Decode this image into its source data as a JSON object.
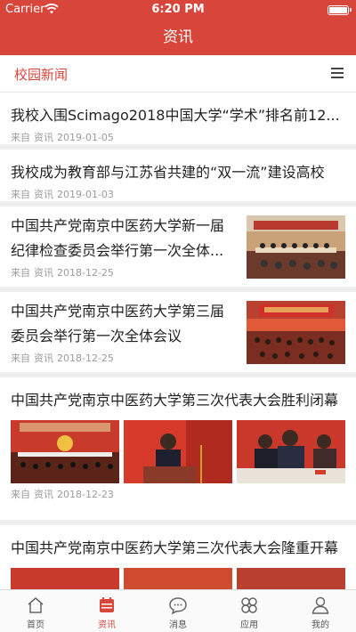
{
  "status_bar": {
    "carrier": "Carrier",
    "time": "6:20 PM"
  },
  "nav": {
    "title": "资讯"
  },
  "section": {
    "title": "校园新闻"
  },
  "articles": [
    {
      "title": "我校入围Scimago2018中国大学“学术”排名前12...",
      "source_prefix": "来自",
      "source": "资讯",
      "date": "2019-01-05"
    },
    {
      "title": "我校成为教育部与江苏省共建的“双一流”建设高校",
      "source_prefix": "来自",
      "source": "资讯",
      "date": "2019-01-03"
    },
    {
      "title": "中国共产党南京中医药大学新一届纪律检查委员会举行第一次全体...",
      "source_prefix": "来自",
      "source": "资讯",
      "date": "2018-12-25"
    },
    {
      "title": "中国共产党南京中医药大学第三届委员会举行第一次全体会议",
      "source_prefix": "来自",
      "source": "资讯",
      "date": "2018-12-25"
    },
    {
      "title": "中国共产党南京中医药大学第三次代表大会胜利闭幕",
      "source_prefix": "来自",
      "source": "资讯",
      "date": "2018-12-23"
    },
    {
      "title": "中国共产党南京中医药大学第三次代表大会隆重开幕"
    }
  ],
  "tabs": [
    {
      "label": "首页",
      "icon": "home-icon"
    },
    {
      "label": "资讯",
      "icon": "calendar-icon",
      "active": true
    },
    {
      "label": "消息",
      "icon": "chat-icon"
    },
    {
      "label": "应用",
      "icon": "apps-icon"
    },
    {
      "label": "我的",
      "icon": "user-icon"
    }
  ],
  "colors": {
    "brand": "#d8453a",
    "tab_active": "#d8453a",
    "meta_text": "#9a9a9a"
  }
}
